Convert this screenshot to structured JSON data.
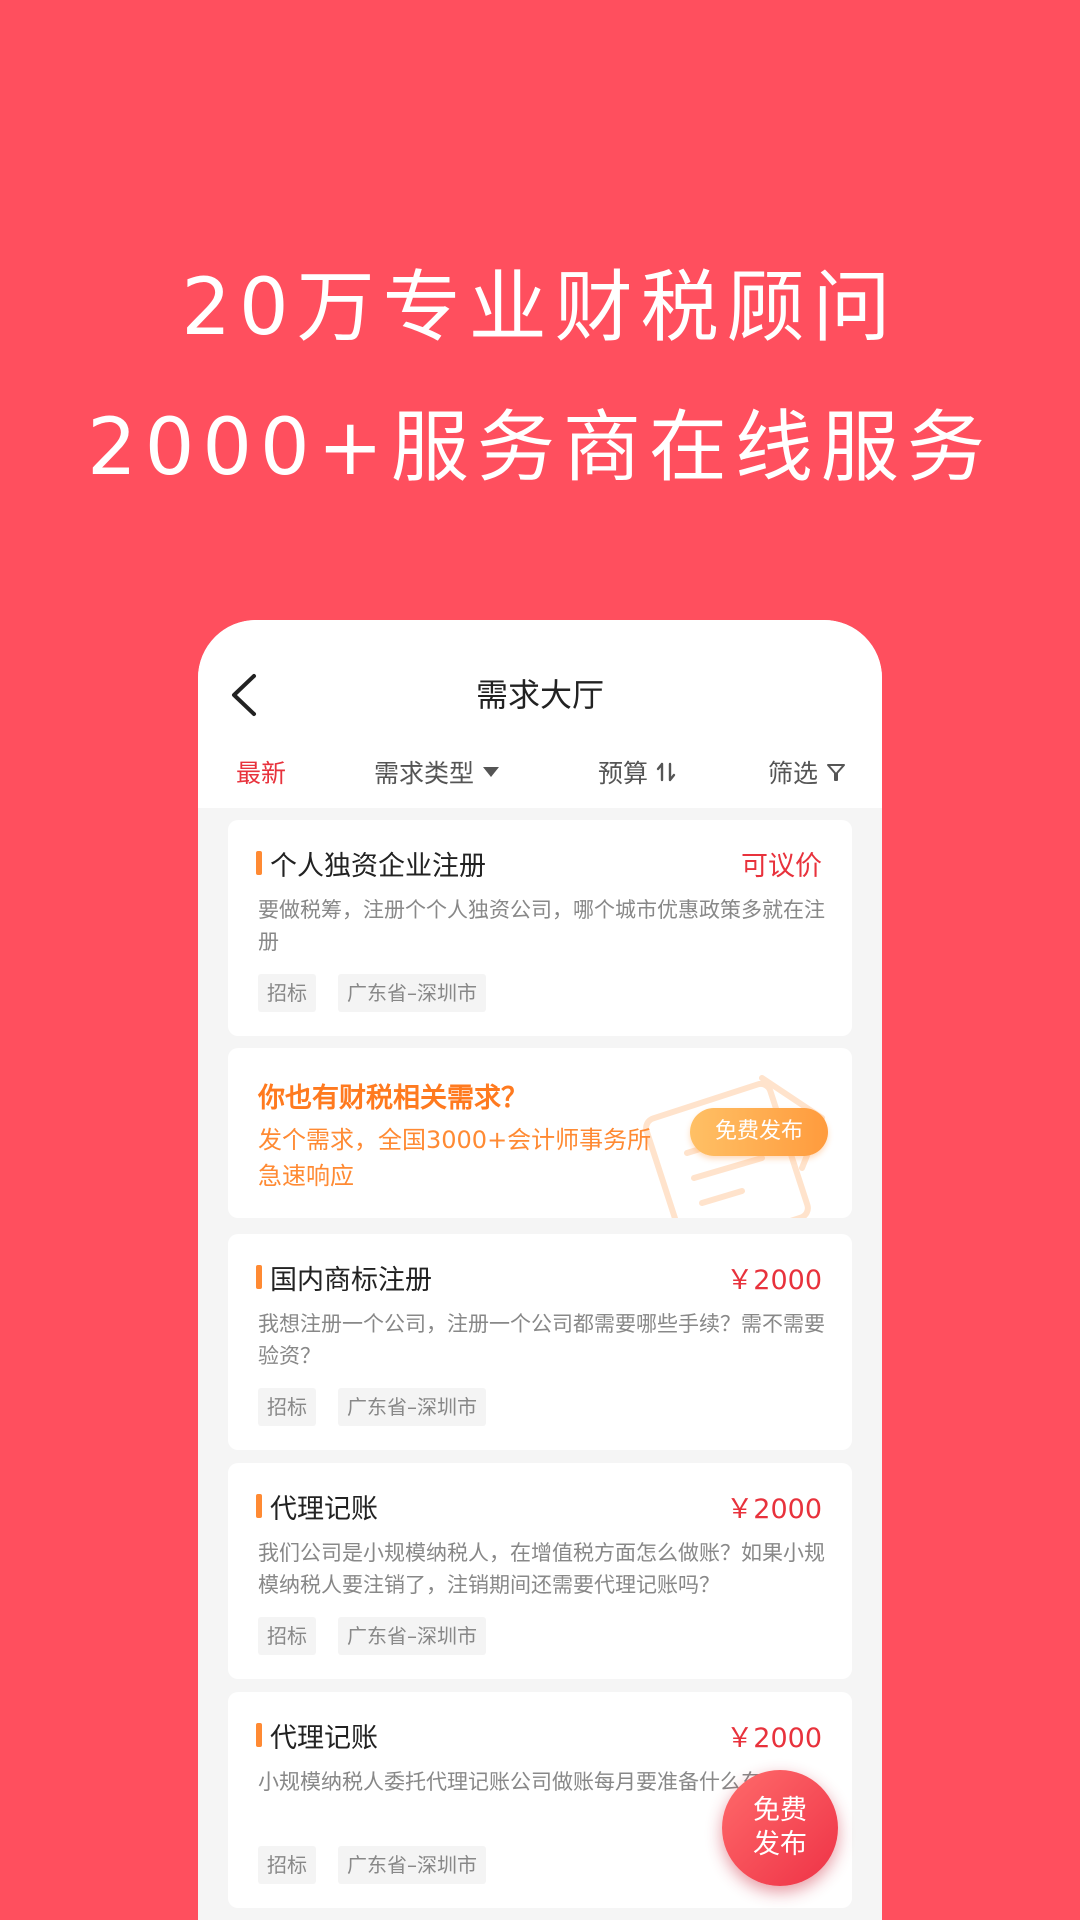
{
  "headline": {
    "line1": "20万专业财税顾问",
    "line2": "2000+服务商在线服务"
  },
  "nav": {
    "back_icon": "chevron-left-icon",
    "title": "需求大厅"
  },
  "filters": {
    "latest": "最新",
    "type": "需求类型",
    "budget": "预算",
    "screen": "筛选",
    "active_color": "#e8323c"
  },
  "cards": [
    {
      "title": "个人独资企业注册",
      "price": "可议价",
      "desc": "要做税筹，注册个个人独资公司，哪个城市优惠政策多就在注册",
      "tags": [
        "招标",
        "广东省–深圳市"
      ]
    },
    {
      "title": "国内商标注册",
      "price": "￥2000",
      "desc": "我想注册一个公司，注册一个公司都需要哪些手续？需不需要验资？",
      "tags": [
        "招标",
        "广东省–深圳市"
      ]
    },
    {
      "title": "代理记账",
      "price": "￥2000",
      "desc": "我们公司是小规模纳税人，在增值税方面怎么做账？如果小规模纳税人要注销了，注销期间还需要代理记账吗？",
      "tags": [
        "招标",
        "广东省–深圳市"
      ]
    },
    {
      "title": "代理记账",
      "price": "￥2000",
      "desc": "小规模纳税人委托代理记账公司做账每月要准备什么东西？",
      "tags": [
        "招标",
        "广东省–深圳市"
      ]
    }
  ],
  "promo": {
    "title": "你也有财税相关需求？",
    "desc": "发个需求，全国3000+会计师事务所急速响应",
    "button": "免费发布"
  },
  "fab": {
    "line1": "免费",
    "line2": "发布"
  },
  "colors": {
    "background": "#ff4f5e",
    "accent_red": "#e8323c",
    "accent_orange": "#ff8a33"
  }
}
